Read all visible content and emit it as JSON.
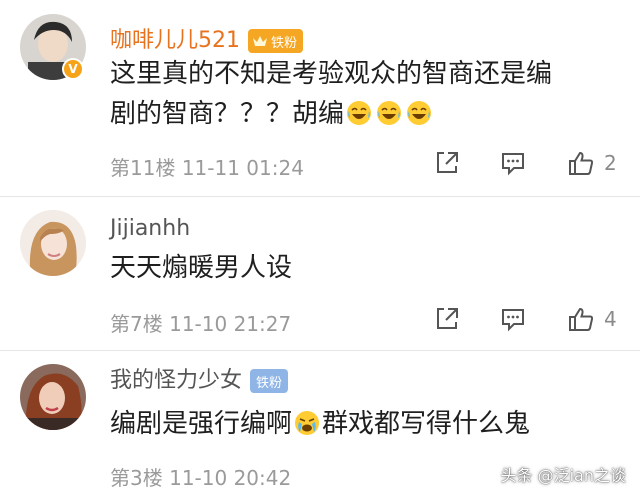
{
  "comments": [
    {
      "username": "咖啡儿儿521",
      "badge": "铁粉",
      "content_line1": "这里真的不知是考验观众的智商还是编",
      "content_line2": "剧的智商？？？胡编",
      "floor": "第11楼",
      "time": "11-11 01:24",
      "likes": "2"
    },
    {
      "username": "Jijianhh",
      "content_line1": "天天煽暖男人设",
      "floor": "第7楼",
      "time": "11-10 21:27",
      "likes": "4"
    },
    {
      "username": "我的怪力少女",
      "badge": "铁粉",
      "content_line1_a": "编剧是强行编啊",
      "content_line1_b": "群戏都写得什么鬼",
      "floor": "第3楼",
      "time": "11-10 20:42"
    }
  ],
  "watermark": "头条 @泛ian之谈",
  "colors": {
    "vip_name": "#e8731f",
    "normal_name": "#555555",
    "gold_badge": "#f5a623",
    "blue_badge": "#8fb4e6",
    "meta_text": "#9a9a9a"
  },
  "icons": [
    "share-icon",
    "comment-icon",
    "thumbs-up-icon",
    "laugh-cry-emoji",
    "crying-emoji",
    "crown-icon",
    "verified-icon"
  ]
}
